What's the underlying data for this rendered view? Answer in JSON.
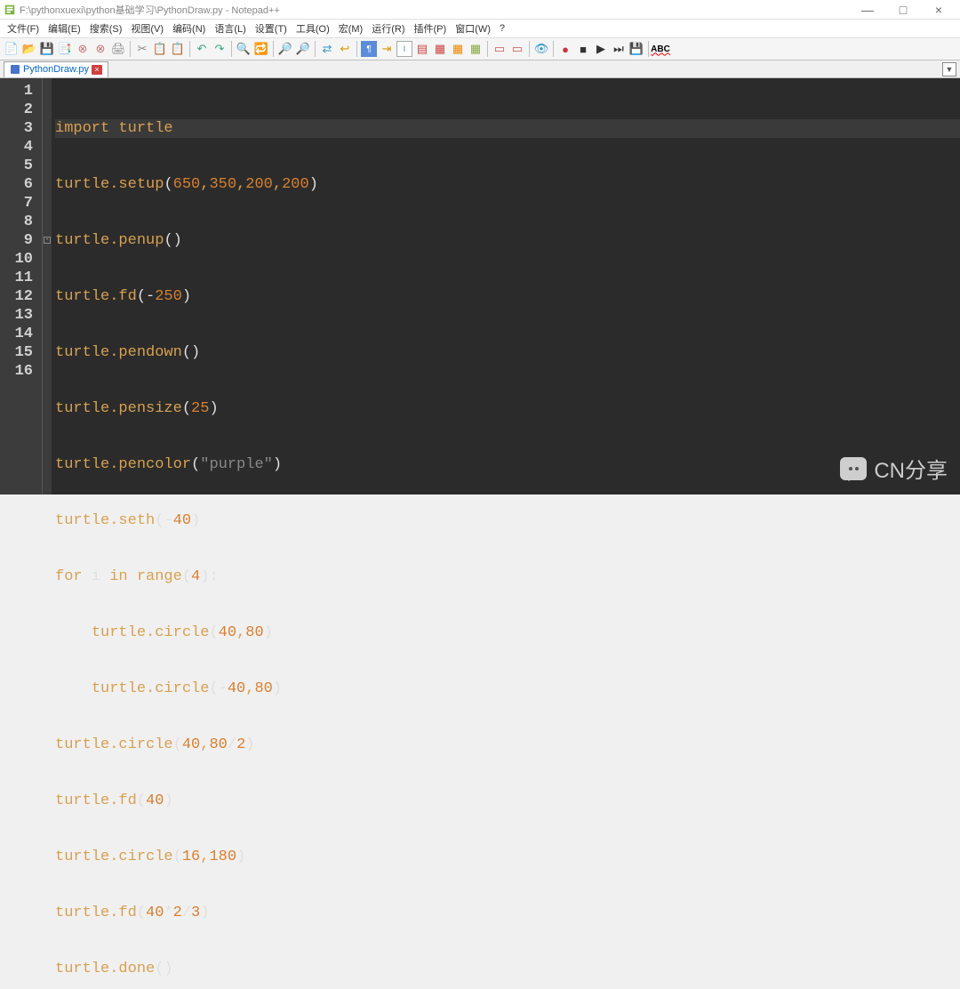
{
  "titlebar": {
    "title": "F:\\pythonxuexi\\python基础学习\\PythonDraw.py - Notepad++",
    "minimize": "—",
    "maximize": "□",
    "close": "×"
  },
  "menubar": {
    "items": [
      "文件(F)",
      "编辑(E)",
      "搜索(S)",
      "视图(V)",
      "编码(N)",
      "语言(L)",
      "设置(T)",
      "工具(O)",
      "宏(M)",
      "运行(R)",
      "插件(P)",
      "窗口(W)",
      "?"
    ]
  },
  "tab": {
    "filename": "PythonDraw.py",
    "close": "×",
    "overflow": "▼"
  },
  "gutter": {
    "lines": [
      "1",
      "2",
      "3",
      "4",
      "5",
      "6",
      "7",
      "8",
      "9",
      "10",
      "11",
      "12",
      "13",
      "14",
      "15",
      "16"
    ]
  },
  "code": {
    "l1": {
      "a": "import",
      "b": " ",
      "c": "turtle"
    },
    "l2": {
      "a": "turtle",
      "b": ".",
      "c": "setup",
      "d": "(",
      "e": "650",
      "f": ",",
      "g": "350",
      "h": ",",
      "i": "200",
      "j": ",",
      "k": "200",
      "l": ")"
    },
    "l3": {
      "a": "turtle",
      "b": ".",
      "c": "penup",
      "d": "()"
    },
    "l4": {
      "a": "turtle",
      "b": ".",
      "c": "fd",
      "d": "(",
      "e": "-",
      "f": "250",
      "g": ")"
    },
    "l5": {
      "a": "turtle",
      "b": ".",
      "c": "pendown",
      "d": "()"
    },
    "l6": {
      "a": "turtle",
      "b": ".",
      "c": "pensize",
      "d": "(",
      "e": "25",
      "f": ")"
    },
    "l7": {
      "a": "turtle",
      "b": ".",
      "c": "pencolor",
      "d": "(",
      "e": "\"purple\"",
      "f": ")"
    },
    "l8": {
      "a": "turtle",
      "b": ".",
      "c": "seth",
      "d": "(",
      "e": "-",
      "f": "40",
      "g": ")"
    },
    "l9": {
      "a": "for",
      "b": " i ",
      "c": "in",
      "d": " ",
      "e": "range",
      "f": "(",
      "g": "4",
      "h": "):"
    },
    "l10": {
      "a": "    ",
      "b": "turtle",
      "c": ".",
      "d": "circle",
      "e": "(",
      "f": "40",
      "g": ",",
      "h": "80",
      "i": ")"
    },
    "l11": {
      "a": "    ",
      "b": "turtle",
      "c": ".",
      "d": "circle",
      "e": "(",
      "f": "-",
      "g": "40",
      "h": ",",
      "i": "80",
      "j": ")"
    },
    "l12": {
      "a": "turtle",
      "b": ".",
      "c": "circle",
      "d": "(",
      "e": "40",
      "f": ",",
      "g": "80",
      "h": "/",
      "i": "2",
      "j": ")"
    },
    "l13": {
      "a": "turtle",
      "b": ".",
      "c": "fd",
      "d": "(",
      "e": "40",
      "f": ")"
    },
    "l14": {
      "a": "turtle",
      "b": ".",
      "c": "circle",
      "d": "(",
      "e": "16",
      "f": ",",
      "g": "180",
      "h": ")"
    },
    "l15": {
      "a": "turtle",
      "b": ".",
      "c": "fd",
      "d": "(",
      "e": "40",
      "f": "*",
      "g": "2",
      "h": "/",
      "i": "3",
      "j": ")"
    },
    "l16": {
      "a": "turtle",
      "b": ".",
      "c": "done",
      "d": "()"
    }
  },
  "watermark": {
    "text": "CN分享"
  },
  "toolbar_icons": [
    "new",
    "open",
    "save",
    "saveall",
    "close",
    "closeall",
    "print",
    "",
    "cut",
    "copy",
    "paste",
    "",
    "undo",
    "redo",
    "",
    "find",
    "replace",
    "",
    "zoomin",
    "zoomout",
    "",
    "sync",
    "wrap",
    "allchars",
    "indent",
    "foldall",
    "unfoldall",
    "hidden",
    "",
    "doc1",
    "doc2",
    "",
    "eye",
    "",
    "rec",
    "play",
    "playall",
    "stop",
    "",
    "macro",
    "",
    "spellcheck"
  ]
}
